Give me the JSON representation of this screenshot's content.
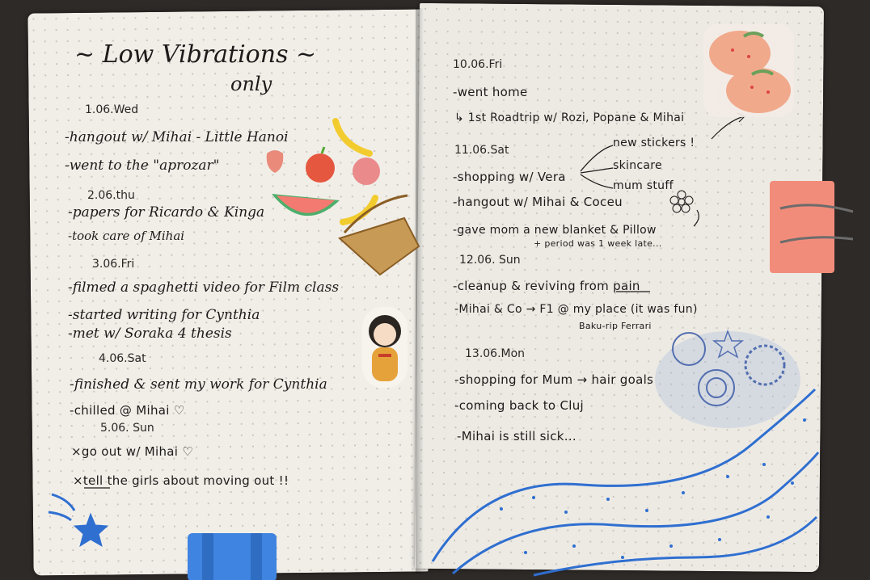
{
  "left_page": {
    "title": "~ Low Vibrations ~",
    "subtitle": "only",
    "days": [
      {
        "date": "1.06.Wed",
        "items": [
          "-hangout w/ Mihai - Little Hanoi",
          "-went to the \"aprozar\""
        ]
      },
      {
        "date": "2.06.thu",
        "items": [
          "-papers for Ricardo & Kinga",
          "-took care of Mihai"
        ]
      },
      {
        "date": "3.06.Fri",
        "items": [
          "-filmed a spaghetti video for Film class",
          "-started writing for Cynthia",
          "-met w/ Soraka 4 thesis"
        ]
      },
      {
        "date": "4.06.Sat",
        "items": [
          "-finished & sent my work for Cynthia",
          "-chilled @ Mihai ♡"
        ]
      },
      {
        "date": "5.06. Sun",
        "items": [
          "×go out w/ Mihai ♡",
          "×tell the girls about moving out !!"
        ]
      }
    ]
  },
  "right_page": {
    "days": [
      {
        "date": "10.06.Fri",
        "items": [
          "-went home",
          "↳ 1st Roadtrip w/ Rozi, Popane & Mihai"
        ]
      },
      {
        "date": "11.06.Sat",
        "items": [
          "-shopping w/ Vera",
          "-hangout w/ Mihai & Coceu",
          "-gave mom a new blanket & Pillow"
        ]
      },
      {
        "date": "12.06. Sun",
        "items": [
          "-cleanup & reviving from pain",
          "-Mihai & Co → F1 @ my place (it was fun)"
        ]
      },
      {
        "date": "13.06.Mon",
        "items": [
          "-shopping for Mum → hair goals",
          "-coming back to Cluj",
          "-Mihai is still sick..."
        ]
      }
    ],
    "branch_labels": [
      "new stickers !",
      "skincare",
      "mum stuff"
    ],
    "note_period": "+ period was 1 week late...",
    "note_baku": "Baku-rip Ferrari"
  },
  "colors": {
    "ink": "#1d1b1a",
    "paper": "#f1eee8",
    "blue": "#2f6fd0",
    "clip_blue": "#3f84e0",
    "clip_pink": "#f28c7a"
  }
}
